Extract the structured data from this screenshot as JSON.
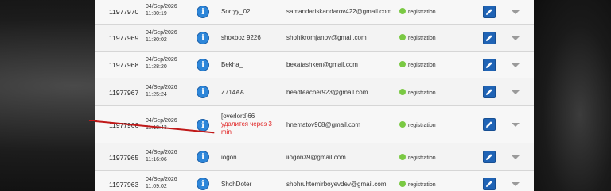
{
  "rows": [
    {
      "id": "11977970",
      "date": "04/Sep/2026",
      "time": "11:30:19",
      "user": "Sorryy_02",
      "warning": "",
      "email": "samandariskandarov422@gmail.com",
      "status": "registration"
    },
    {
      "id": "11977969",
      "date": "04/Sep/2026",
      "time": "11:30:02",
      "user": "shoxboz 9226",
      "warning": "",
      "email": "shohikromjanov@gmail.com",
      "status": "registration"
    },
    {
      "id": "11977968",
      "date": "04/Sep/2026",
      "time": "11:28:20",
      "user": "Bekha_",
      "warning": "",
      "email": "bexatashken@gmail.com",
      "status": "registration"
    },
    {
      "id": "11977967",
      "date": "04/Sep/2026",
      "time": "11:25:24",
      "user": "Z714AA",
      "warning": "",
      "email": "headteacher923@gmail.com",
      "status": "registration"
    },
    {
      "id": "11977966",
      "date": "04/Sep/2026",
      "time": "11:18:43",
      "user": "[overlord]66",
      "warning": "удалится через 3 min",
      "email": "hnematov908@gmail.com",
      "status": "registration"
    },
    {
      "id": "11977965",
      "date": "04/Sep/2026",
      "time": "11:16:06",
      "user": "iogon",
      "warning": "",
      "email": "iiogon39@gmail.com",
      "status": "registration"
    },
    {
      "id": "11977963",
      "date": "04/Sep/2026",
      "time": "11:09:02",
      "user": "ShohDoter",
      "warning": "",
      "email": "shohruhtemirboyevdev@gmail.com",
      "status": "registration"
    }
  ],
  "icons": {
    "info": "info-icon",
    "edit": "pencil-icon",
    "expand": "chevron-down-icon",
    "status": "status-dot"
  },
  "colors": {
    "status_dot": "#7ac943",
    "info": "#2d86d9",
    "edit": "#1f63b5",
    "warning": "#e02020",
    "annotation_arrow": "#c01818"
  }
}
